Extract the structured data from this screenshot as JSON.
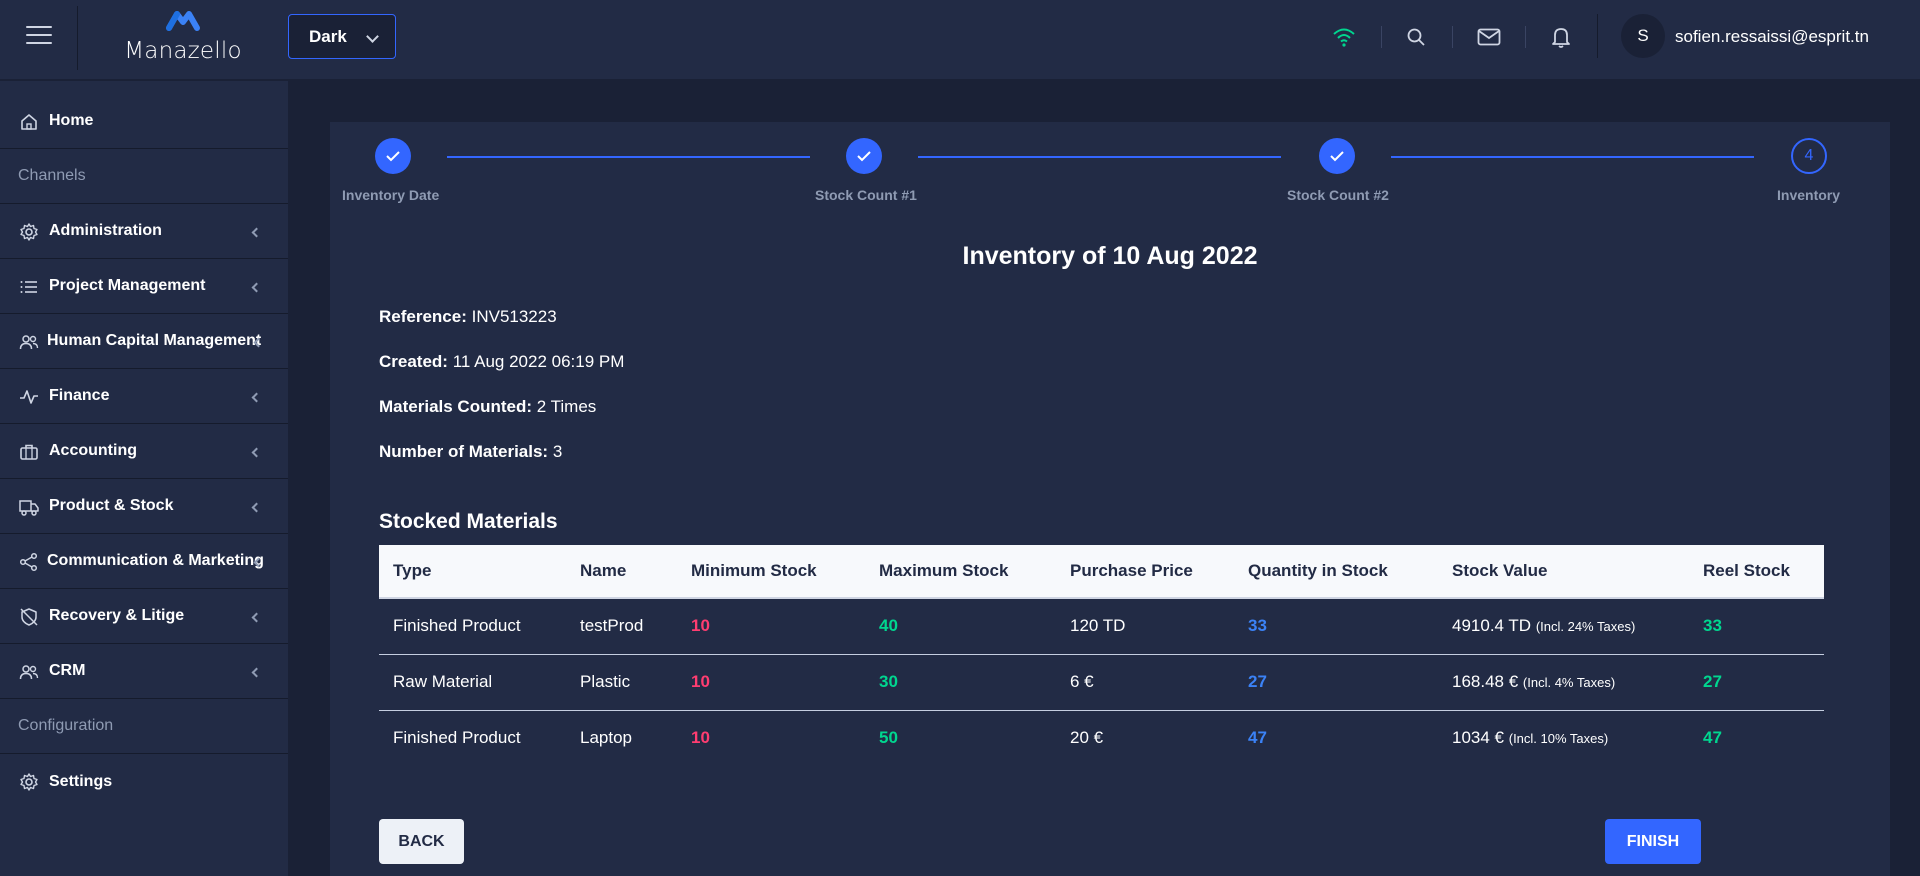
{
  "app": {
    "name": "Manazello",
    "theme": "Dark",
    "user_initial": "S",
    "user_email": "sofien.ressaissi@esprit.tn"
  },
  "colors": {
    "background": "#1a2136",
    "panel": "#222b45",
    "primary": "#3366ff",
    "danger": "#ff3d71",
    "success": "#00d68f",
    "info": "#3b82f6"
  },
  "header_icons": [
    "wifi-icon",
    "search-icon",
    "mail-icon",
    "bell-icon"
  ],
  "sidebar": {
    "items": [
      {
        "label": "Home",
        "icon": "home-icon"
      },
      {
        "group": "Channels"
      },
      {
        "label": "Administration",
        "icon": "gear-icon"
      },
      {
        "label": "Project Management",
        "icon": "list-icon"
      },
      {
        "label": "Human Capital Management",
        "icon": "people-icon"
      },
      {
        "label": "Finance",
        "icon": "activity-icon"
      },
      {
        "label": "Accounting",
        "icon": "briefcase-icon"
      },
      {
        "label": "Product & Stock",
        "icon": "truck-icon"
      },
      {
        "label": "Communication & Marketing",
        "icon": "share-icon"
      },
      {
        "label": "Recovery & Litige",
        "icon": "shield-off-icon"
      },
      {
        "label": "CRM",
        "icon": "people-icon"
      },
      {
        "group": "Configuration"
      },
      {
        "label": "Settings",
        "icon": "gear-icon"
      }
    ]
  },
  "stepper": {
    "steps": [
      {
        "label": "Inventory Date",
        "state": "done"
      },
      {
        "label": "Stock Count #1",
        "state": "done"
      },
      {
        "label": "Stock Count #2",
        "state": "done"
      },
      {
        "label": "Inventory",
        "state": "current",
        "number": "4"
      }
    ]
  },
  "inventory": {
    "title": "Inventory of 10 Aug 2022",
    "reference_label": "Reference:",
    "reference": "INV513223",
    "created_label": "Created:",
    "created": "11 Aug 2022 06:19 PM",
    "counted_label": "Materials Counted:",
    "counted": "2 Times",
    "num_label": "Number of Materials:",
    "num": "3"
  },
  "table": {
    "title": "Stocked Materials",
    "headers": [
      "Type",
      "Name",
      "Minimum Stock",
      "Maximum Stock",
      "Purchase Price",
      "Quantity in Stock",
      "Stock Value",
      "Reel Stock"
    ],
    "rows": [
      {
        "type": "Finished Product",
        "name": "testProd",
        "min": "10",
        "max": "40",
        "price": "120 TD",
        "qty": "33",
        "value": "4910.4 TD",
        "tax": "(Incl. 24% Taxes)",
        "reel": "33"
      },
      {
        "type": "Raw Material",
        "name": "Plastic",
        "min": "10",
        "max": "30",
        "price": "6 €",
        "qty": "27",
        "value": "168.48 €",
        "tax": "(Incl. 4% Taxes)",
        "reel": "27"
      },
      {
        "type": "Finished Product",
        "name": "Laptop",
        "min": "10",
        "max": "50",
        "price": "20 €",
        "qty": "47",
        "value": "1034 €",
        "tax": "(Incl. 10% Taxes)",
        "reel": "47"
      }
    ]
  },
  "buttons": {
    "back": "BACK",
    "finish": "FINISH"
  }
}
